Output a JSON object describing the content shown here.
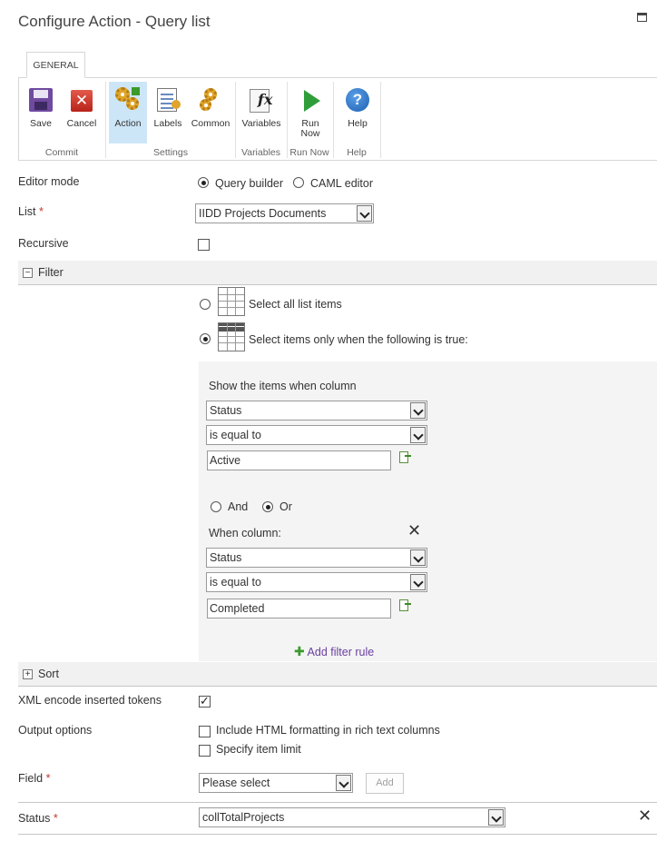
{
  "title": "Configure Action - Query list",
  "ribbon": {
    "tab": "GENERAL",
    "buttons": {
      "save": "Save",
      "cancel": "Cancel",
      "action": "Action",
      "labels": "Labels",
      "common": "Common",
      "variables": "Variables",
      "run_now_1": "Run",
      "run_now_2": "Now",
      "help": "Help"
    },
    "groups": {
      "commit": "Commit",
      "settings": "Settings",
      "variables": "Variables",
      "run_now": "Run Now",
      "help": "Help"
    }
  },
  "form": {
    "editor_mode": {
      "label": "Editor mode",
      "options": [
        "Query builder",
        "CAML editor"
      ],
      "selected": "Query builder"
    },
    "list": {
      "label": "List",
      "required_mark": "*",
      "value": "IIDD Projects Documents"
    },
    "recursive": {
      "label": "Recursive",
      "checked": false
    },
    "filter": {
      "section": "Filter",
      "toggle": "−",
      "select_all": "Select all list items",
      "select_when": "Select items only when the following is true:",
      "show_items": "Show the items when column",
      "rule1": {
        "column": "Status",
        "operator": "is equal to",
        "value": "Active"
      },
      "and": "And",
      "or": "Or",
      "when_column": "When column:",
      "rule2": {
        "column": "Status",
        "operator": "is equal to",
        "value": "Completed"
      },
      "add_rule": "Add filter rule",
      "add_icon": "✚"
    },
    "sort": {
      "section": "Sort",
      "toggle": "+"
    },
    "xml_encode": {
      "label": "XML encode inserted tokens",
      "checked": true
    },
    "output_options": {
      "label": "Output options",
      "include_html": "Include HTML formatting in rich text columns",
      "specify_limit": "Specify item limit"
    },
    "field": {
      "label": "Field",
      "required_mark": "*",
      "value": "Please select",
      "add_button": "Add"
    },
    "status": {
      "label": "Status",
      "required_mark": "*",
      "value": "collTotalProjects"
    }
  },
  "icons": {
    "cancel_glyph": "✕",
    "help_glyph": "?",
    "close_glyph": "✕",
    "fx_glyph": "fx"
  }
}
